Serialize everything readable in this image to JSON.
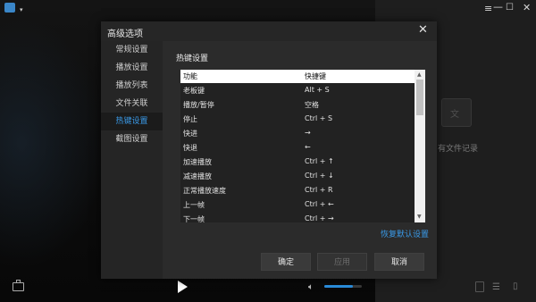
{
  "titlebar": {
    "menu_arrow": "▾",
    "menu_icon": "≡",
    "minimize": "—",
    "maximize": "☐",
    "close": "✕"
  },
  "playlist_panel": {
    "empty_text": "有文件记录"
  },
  "player_controls": {
    "volume_level": 0.75,
    "accent_color": "#2b8fe0"
  },
  "dialog": {
    "title": "高级选项",
    "close_icon": "✕",
    "nav": [
      {
        "label": "常规设置",
        "active": false
      },
      {
        "label": "播放设置",
        "active": false
      },
      {
        "label": "播放列表",
        "active": false
      },
      {
        "label": "文件关联",
        "active": false
      },
      {
        "label": "热键设置",
        "active": true
      },
      {
        "label": "截图设置",
        "active": false
      }
    ],
    "section_title": "热键设置",
    "table": {
      "headers": [
        "功能",
        "快捷键"
      ],
      "rows": [
        [
          "老板键",
          "Alt + S"
        ],
        [
          "播放/暂停",
          "空格"
        ],
        [
          "停止",
          "Ctrl + S"
        ],
        [
          "快进",
          "→"
        ],
        [
          "快退",
          "←"
        ],
        [
          "加速播放",
          "Ctrl + ↑"
        ],
        [
          "减速播放",
          "Ctrl + ↓"
        ],
        [
          "正常播放速度",
          "Ctrl + R"
        ],
        [
          "上一帧",
          "Ctrl + ←"
        ],
        [
          "下一帧",
          "Ctrl + →"
        ]
      ]
    },
    "restore_defaults": "恢复默认设置",
    "buttons": {
      "ok": "确定",
      "apply": "应用",
      "cancel": "取消"
    },
    "accent_color": "#3a9ae8"
  }
}
